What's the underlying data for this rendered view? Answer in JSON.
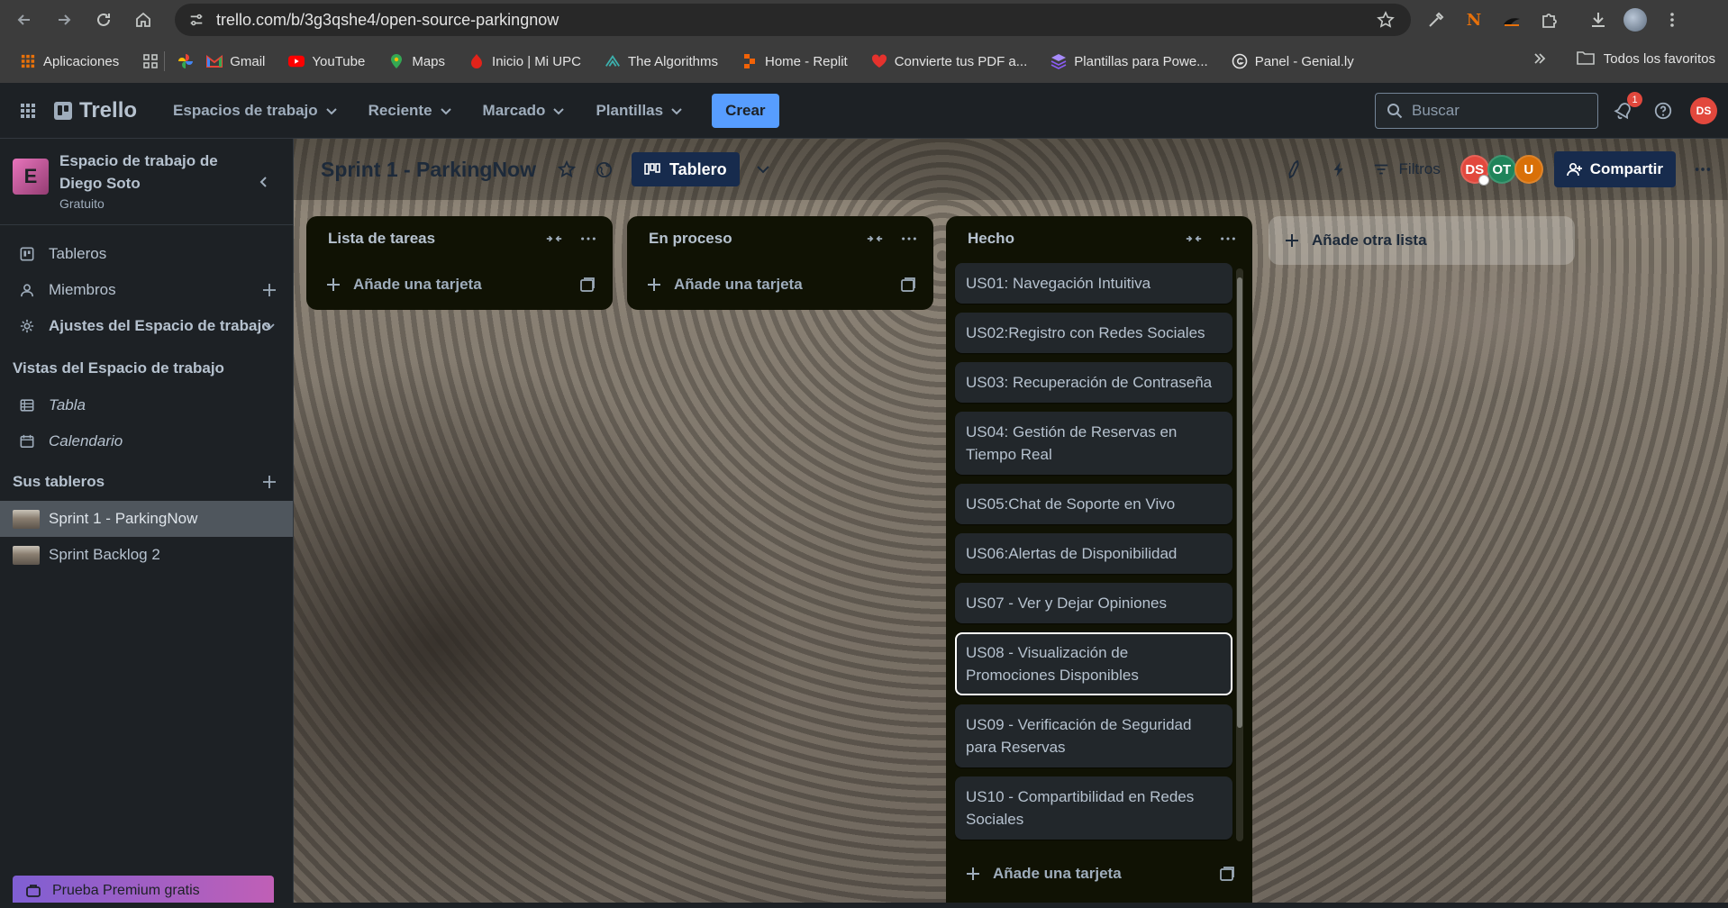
{
  "browser": {
    "url": "trello.com/b/3g3qshe4/open-source-parkingnow",
    "bookmarks": [
      {
        "label": "Aplicaciones",
        "icon": "apps-grid-icon",
        "color": "#e8710a"
      },
      {
        "label": "Gmail",
        "icon": "gmail-icon",
        "color": "#ea4335"
      },
      {
        "label": "YouTube",
        "icon": "youtube-icon",
        "color": "#ff0000"
      },
      {
        "label": "Maps",
        "icon": "maps-pin-icon",
        "color": "#34a853"
      },
      {
        "label": "Inicio | Mi UPC",
        "icon": "upc-icon",
        "color": "#e2231a"
      },
      {
        "label": "The Algorithms",
        "icon": "algorithms-icon",
        "color": "#3cb0ad"
      },
      {
        "label": "Home - Replit",
        "icon": "replit-icon",
        "color": "#f26207"
      },
      {
        "label": "Convierte tus PDF a...",
        "icon": "pdf-heart-icon",
        "color": "#e5322d"
      },
      {
        "label": "Plantillas para Powe...",
        "icon": "templates-icon",
        "color": "#8b5cf6"
      },
      {
        "label": "Panel - Genial.ly",
        "icon": "genially-icon",
        "color": "#e3e3e3"
      }
    ],
    "all_favorites_label": "Todos los favoritos"
  },
  "header": {
    "logo": "Trello",
    "nav": [
      "Espacios de trabajo",
      "Reciente",
      "Marcado",
      "Plantillas"
    ],
    "create_label": "Crear",
    "search_placeholder": "Buscar",
    "notification_count": "1",
    "user_initials": "DS"
  },
  "sidebar": {
    "workspace_initial": "E",
    "workspace_name": "Espacio de trabajo de Diego Soto",
    "workspace_plan": "Gratuito",
    "items": [
      {
        "label": "Tableros"
      },
      {
        "label": "Miembros"
      },
      {
        "label": "Ajustes del Espacio de trabajo"
      }
    ],
    "views_title": "Vistas del Espacio de trabajo",
    "views": [
      {
        "label": "Tabla"
      },
      {
        "label": "Calendario"
      }
    ],
    "boards_title": "Sus tableros",
    "boards": [
      {
        "label": "Sprint 1 - ParkingNow",
        "active": true
      },
      {
        "label": "Sprint Backlog 2",
        "active": false
      }
    ],
    "premium_label": "Prueba Premium gratis"
  },
  "board": {
    "title": "Sprint 1 - ParkingNow",
    "view_label": "Tablero",
    "filters_label": "Filtros",
    "members": [
      {
        "initials": "DS",
        "color": "#e2483d"
      },
      {
        "initials": "OT",
        "color": "#1f845a"
      },
      {
        "initials": "U",
        "color": "#d97008"
      }
    ],
    "share_label": "Compartir",
    "add_list_label": "Añade otra lista",
    "lists": [
      {
        "title": "Lista de tareas",
        "add_card_label": "Añade una tarjeta",
        "cards": []
      },
      {
        "title": "En proceso",
        "add_card_label": "Añade una tarjeta",
        "cards": []
      },
      {
        "title": "Hecho",
        "add_card_label": "Añade una tarjeta",
        "cards": [
          "US01: Navegación Intuitiva",
          "US02:Registro con Redes Sociales",
          "US03: Recuperación de Contraseña",
          "US04: Gestión de Reservas en Tiempo Real",
          "US05:Chat de Soporte en Vivo",
          "US06:Alertas de Disponibilidad",
          "US07 - Ver y Dejar Opiniones",
          "US08 - Visualización de Promociones Disponibles",
          "US09 - Verificación de Seguridad para Reservas",
          "US10 - Compartibilidad en Redes Sociales"
        ]
      }
    ]
  }
}
